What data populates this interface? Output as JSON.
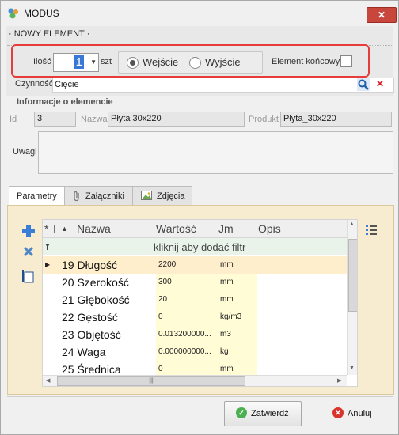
{
  "window": {
    "title": "MODUS",
    "close_glyph": "✕"
  },
  "section": {
    "label": "· NOWY ELEMENT ·"
  },
  "quantity": {
    "label": "Ilość",
    "value": "1",
    "unit": "szt"
  },
  "direction": {
    "options": [
      "Wejście",
      "Wyjście"
    ],
    "selected": "Wejście"
  },
  "element_koncowy": {
    "label": "Element końcowy"
  },
  "czynnosc": {
    "label": "Czynność",
    "value": "Cięcie"
  },
  "info": {
    "title": "Informacje o elemencie",
    "id_label": "Id",
    "id_value": "3",
    "nazwa_label": "Nazwa",
    "nazwa_value": "Płyta 30x220",
    "produkt_label": "Produkt",
    "produkt_value": "Płyta_30x220",
    "uwagi_label": "Uwagi",
    "uwagi_value": ""
  },
  "tabs": [
    "Parametry",
    "Załączniki",
    "Zdjęcia"
  ],
  "grid": {
    "headers": {
      "col_star": "*",
      "col_i": "I",
      "sort": "▲",
      "nazwa": "Nazwa",
      "wartosc": "Wartość",
      "jm": "Jm",
      "opis": "Opis"
    },
    "filter_text": "kliknij aby dodać filtr",
    "rows": [
      {
        "name": "19 Długość",
        "value": "2200",
        "jm": "mm"
      },
      {
        "name": "20 Szerokość",
        "value": "300",
        "jm": "mm"
      },
      {
        "name": "21 Głębokość",
        "value": "20",
        "jm": "mm"
      },
      {
        "name": "22 Gęstość",
        "value": "0",
        "jm": "kg/m3"
      },
      {
        "name": "23 Objętość",
        "value": "0.013200000...",
        "jm": "m3"
      },
      {
        "name": "24 Waga",
        "value": "0.000000000...",
        "jm": "kg"
      },
      {
        "name": "25 Średnica",
        "value": "0",
        "jm": "mm"
      }
    ]
  },
  "buttons": {
    "confirm": "Zatwierdź",
    "cancel": "Anuluj"
  }
}
